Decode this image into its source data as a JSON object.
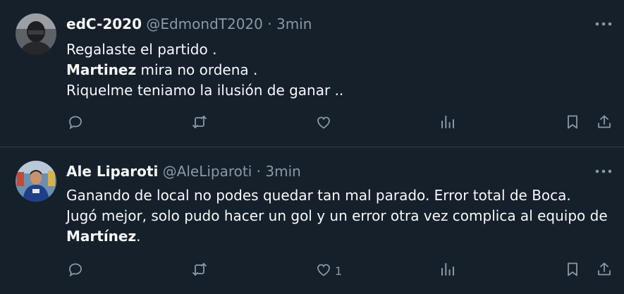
{
  "tweets": [
    {
      "display_name": "edC-2020",
      "handle": "@EdmondT2020",
      "separator": "·",
      "time": "3min",
      "lines": [
        [
          {
            "t": "Regalaste el partido .",
            "b": false
          }
        ],
        [
          {
            "t": "Martinez",
            "b": true
          },
          {
            "t": " mira no ordena .",
            "b": false
          }
        ],
        [
          {
            "t": "Riquelme teniamo la ilusión de ganar ..",
            "b": false
          }
        ]
      ],
      "like_count": ""
    },
    {
      "display_name": "Ale Liparoti",
      "handle": "@AleLiparoti",
      "separator": "·",
      "time": "3min",
      "lines": [
        [
          {
            "t": "Ganando de local no podes quedar tan mal parado. Error total de Boca.",
            "b": false
          }
        ],
        [
          {
            "t": "Jugó mejor, solo pudo hacer un gol y un error otra vez complica al equipo de",
            "b": false
          }
        ],
        [
          {
            "t": "Martínez",
            "b": true
          },
          {
            "t": ".",
            "b": false
          }
        ]
      ],
      "like_count": "1"
    }
  ],
  "icons": {
    "reply": "reply-icon",
    "retweet": "retweet-icon",
    "like": "like-icon",
    "views": "views-icon",
    "bookmark": "bookmark-icon",
    "share": "share-icon",
    "more": "more-icon"
  },
  "colors": {
    "background": "#15202b",
    "text": "#f7f9f9",
    "muted": "#8b98a5",
    "divider": "#38444d"
  }
}
